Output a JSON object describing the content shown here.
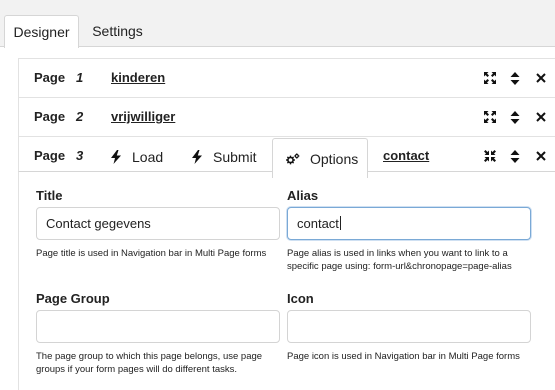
{
  "top_tabs": [
    {
      "label": "Designer",
      "active": true
    },
    {
      "label": "Settings",
      "active": false
    }
  ],
  "pages": [
    {
      "label": "Page",
      "number": "1",
      "name": "kinderen"
    },
    {
      "label": "Page",
      "number": "2",
      "name": "vrijwilliger"
    },
    {
      "label": "Page",
      "number": "3",
      "name": "contact"
    }
  ],
  "page3_tabs": [
    {
      "label": "Load",
      "icon": "bolt-icon"
    },
    {
      "label": "Submit",
      "icon": "bolt-icon"
    },
    {
      "label": "Options",
      "icon": "cogs-icon",
      "active": true
    }
  ],
  "options": {
    "title": {
      "label": "Title",
      "value": "Contact gegevens",
      "help": "Page title is used in Navigation bar in Multi Page forms"
    },
    "alias": {
      "label": "Alias",
      "value": "contact",
      "help": "Page alias is used in links when you want to link to a specific page using: form-url&chronopage=page-alias"
    },
    "group": {
      "label": "Page Group",
      "value": "",
      "help": "The page group to which this page belongs, use page groups if your form pages will do different tasks."
    },
    "icon": {
      "label": "Icon",
      "value": "",
      "help": "Page icon is used in Navigation bar in Multi Page forms"
    }
  },
  "colors": {
    "focus_border": "#7aa9d6",
    "border": "#d4d4d4",
    "tabbar_bg": "#f2f2f2"
  }
}
